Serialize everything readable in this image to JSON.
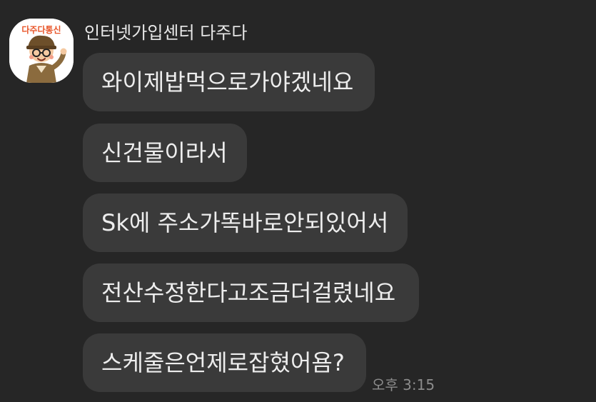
{
  "avatar": {
    "logo_text": "다주다통신",
    "brand_color": "#e8562a"
  },
  "sender": {
    "name": "인터넷가입센터 다주다"
  },
  "messages": [
    {
      "text": "와이제밥먹으로가야겠네요"
    },
    {
      "text": "신건물이라서"
    },
    {
      "text": "Sk에 주소가똑바로안되있어서"
    },
    {
      "text": "전산수정한다고조금더걸렸네요"
    },
    {
      "text": "스케줄은언제로잡혔어욤?"
    }
  ],
  "timestamp": "오후 3:15",
  "colors": {
    "background": "#262626",
    "bubble": "#3a3a3a",
    "text": "#ededed",
    "timestamp": "#8c8c8c"
  }
}
